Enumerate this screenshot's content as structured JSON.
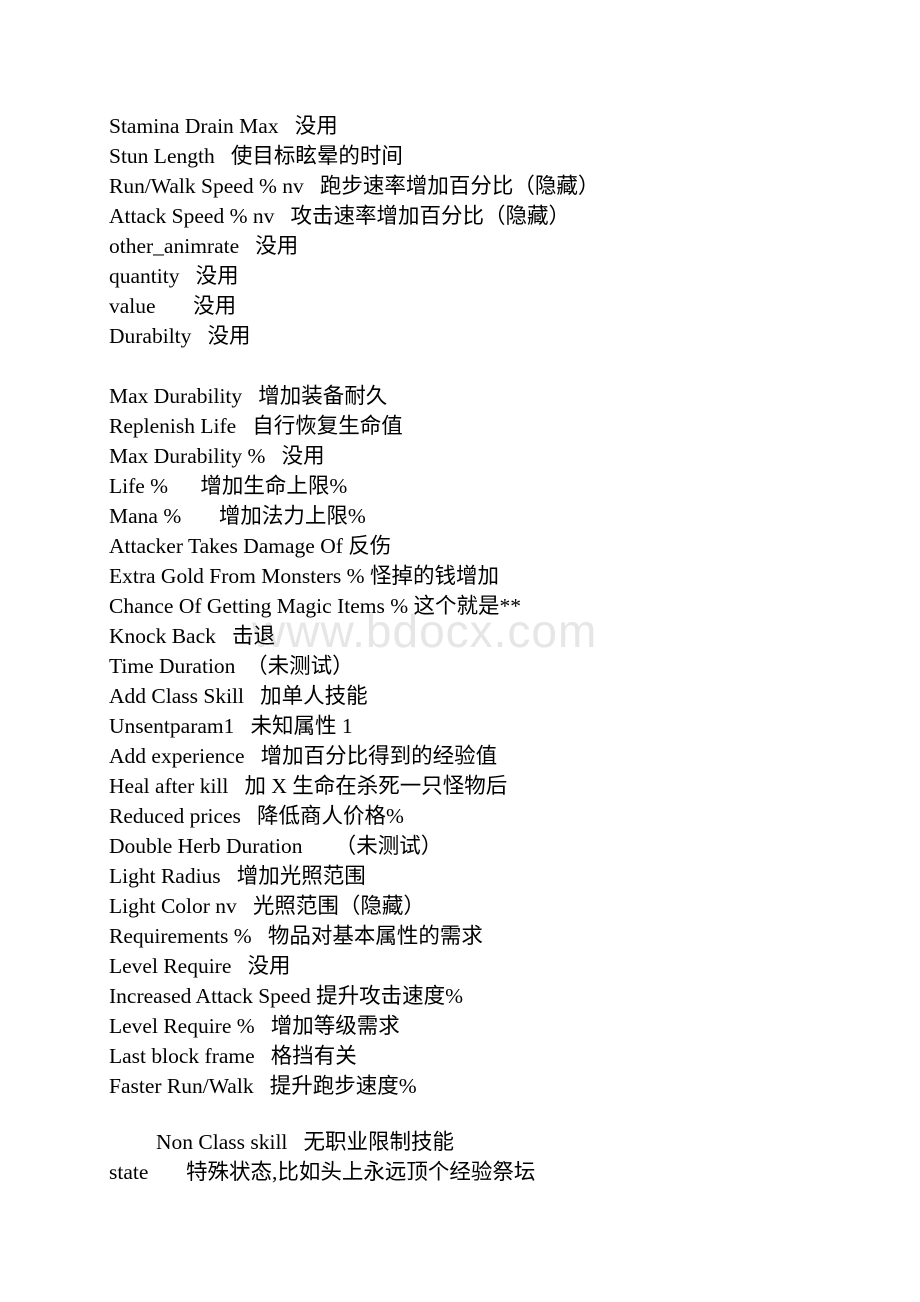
{
  "document": {
    "watermark": "www.bdocx.com",
    "blocks": [
      {
        "id": "block-1",
        "lines": [
          "Stamina Drain Max   没用",
          "Stun Length   使目标眩晕的时间",
          "Run/Walk Speed % nv   跑步速率增加百分比（隐藏）",
          "Attack Speed % nv   攻击速率增加百分比（隐藏）",
          "other_animrate   没用",
          "quantity   没用",
          "value       没用",
          "Durabilty   没用"
        ]
      },
      {
        "id": "block-2",
        "lines": [
          "Max Durability   增加装备耐久",
          "Replenish Life   自行恢复生命值",
          "Max Durability %   没用",
          "Life %      增加生命上限%",
          "Mana %       增加法力上限%",
          "Attacker Takes Damage Of 反伤",
          "Extra Gold From Monsters % 怪掉的钱增加",
          "Chance Of Getting Magic Items % 这个就是**",
          "Knock Back   击退",
          "Time Duration  （未测试）",
          "Add Class Skill   加单人技能",
          "Unsentparam1   未知属性 1",
          "Add experience   增加百分比得到的经验值",
          "Heal after kill   加 X 生命在杀死一只怪物后",
          "Reduced prices   降低商人价格%",
          "Double Herb Duration      （未测试）",
          "Light Radius   增加光照范围",
          "Light Color nv   光照范围（隐藏）",
          "Requirements %   物品对基本属性的需求",
          "Level Require   没用",
          "Increased Attack Speed 提升攻击速度%",
          "Level Require %   增加等级需求",
          "Last block frame   格挡有关",
          "Faster Run/Walk   提升跑步速度%"
        ]
      },
      {
        "id": "block-3",
        "lines": [
          "Non Class skill   无职业限制技能"
        ],
        "indented": true
      },
      {
        "id": "block-4",
        "lines": [
          "state       特殊状态,比如头上永远顶个经验祭坛"
        ]
      }
    ]
  }
}
